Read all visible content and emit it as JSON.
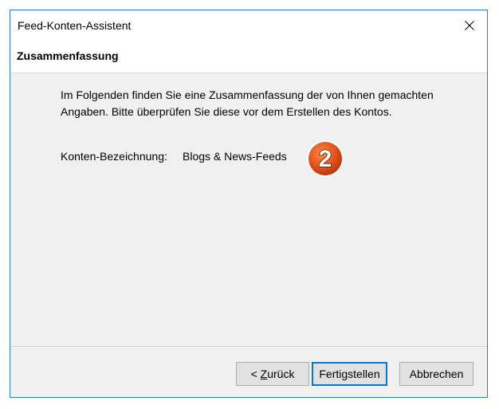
{
  "window": {
    "title": "Feed-Konten-Assistent"
  },
  "header": {
    "title": "Zusammenfassung"
  },
  "content": {
    "description": "Im Folgenden finden Sie eine Zusammenfassung der von Ihnen gemachten Angaben. Bitte überprüfen Sie diese vor dem Erstellen des Kontos.",
    "account_name_label": "Konten-Bezeichnung:",
    "account_name_value": "Blogs & News-Feeds",
    "step_badge": "2"
  },
  "buttons": {
    "back_prefix": "< ",
    "back_mnemonic": "Z",
    "back_rest": "urück",
    "finish": "Fertigstellen",
    "cancel": "Abbrechen"
  },
  "colors": {
    "window_border": "#2b7bd6",
    "badge": "#e8531b",
    "focus": "#0078d7"
  }
}
